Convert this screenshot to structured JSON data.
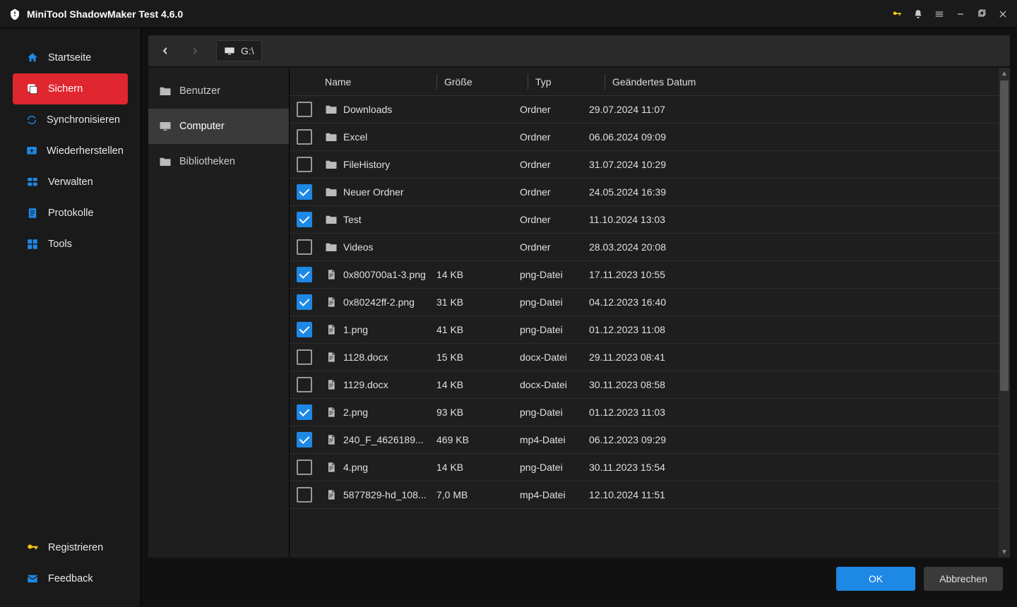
{
  "titlebar": {
    "title": "MiniTool ShadowMaker Test 4.6.0"
  },
  "sidebar": {
    "items": [
      {
        "label": "Startseite",
        "icon": "home"
      },
      {
        "label": "Sichern",
        "icon": "backup",
        "active": true
      },
      {
        "label": "Synchronisieren",
        "icon": "sync"
      },
      {
        "label": "Wiederherstellen",
        "icon": "restore"
      },
      {
        "label": "Verwalten",
        "icon": "manage"
      },
      {
        "label": "Protokolle",
        "icon": "logs"
      },
      {
        "label": "Tools",
        "icon": "tools"
      }
    ],
    "bottom": [
      {
        "label": "Registrieren",
        "icon": "key"
      },
      {
        "label": "Feedback",
        "icon": "mail"
      }
    ]
  },
  "toolbar": {
    "path": "G:\\"
  },
  "tree": {
    "items": [
      {
        "label": "Benutzer",
        "icon": "folder"
      },
      {
        "label": "Computer",
        "icon": "monitor",
        "selected": true
      },
      {
        "label": "Bibliotheken",
        "icon": "folder"
      }
    ]
  },
  "columns": {
    "name": "Name",
    "size": "Größe",
    "type": "Typ",
    "date": "Geändertes Datum"
  },
  "files": [
    {
      "checked": false,
      "icon": "folder",
      "name": "Downloads",
      "size": "",
      "type": "Ordner",
      "date": "29.07.2024 11:07"
    },
    {
      "checked": false,
      "icon": "folder",
      "name": "Excel",
      "size": "",
      "type": "Ordner",
      "date": "06.06.2024 09:09"
    },
    {
      "checked": false,
      "icon": "folder",
      "name": "FileHistory",
      "size": "",
      "type": "Ordner",
      "date": "31.07.2024 10:29"
    },
    {
      "checked": true,
      "icon": "folder",
      "name": "Neuer Ordner",
      "size": "",
      "type": "Ordner",
      "date": "24.05.2024 16:39"
    },
    {
      "checked": true,
      "icon": "folder",
      "name": "Test",
      "size": "",
      "type": "Ordner",
      "date": "11.10.2024 13:03"
    },
    {
      "checked": false,
      "icon": "folder",
      "name": "Videos",
      "size": "",
      "type": "Ordner",
      "date": "28.03.2024 20:08"
    },
    {
      "checked": true,
      "icon": "file",
      "name": "0x800700a1-3.png",
      "size": "14 KB",
      "type": "png-Datei",
      "date": "17.11.2023 10:55"
    },
    {
      "checked": true,
      "icon": "file",
      "name": "0x80242ff-2.png",
      "size": "31 KB",
      "type": "png-Datei",
      "date": "04.12.2023 16:40"
    },
    {
      "checked": true,
      "icon": "file",
      "name": "1.png",
      "size": "41 KB",
      "type": "png-Datei",
      "date": "01.12.2023 11:08"
    },
    {
      "checked": false,
      "icon": "file",
      "name": "1128.docx",
      "size": "15 KB",
      "type": "docx-Datei",
      "date": "29.11.2023 08:41"
    },
    {
      "checked": false,
      "icon": "file",
      "name": "1129.docx",
      "size": "14 KB",
      "type": "docx-Datei",
      "date": "30.11.2023 08:58"
    },
    {
      "checked": true,
      "icon": "file",
      "name": "2.png",
      "size": "93 KB",
      "type": "png-Datei",
      "date": "01.12.2023 11:03"
    },
    {
      "checked": true,
      "icon": "file",
      "name": "240_F_4626189...",
      "size": "469 KB",
      "type": "mp4-Datei",
      "date": "06.12.2023 09:29"
    },
    {
      "checked": false,
      "icon": "file",
      "name": "4.png",
      "size": "14 KB",
      "type": "png-Datei",
      "date": "30.11.2023 15:54"
    },
    {
      "checked": false,
      "icon": "file",
      "name": "5877829-hd_108...",
      "size": "7,0 MB",
      "type": "mp4-Datei",
      "date": "12.10.2024 11:51"
    }
  ],
  "footer": {
    "ok": "OK",
    "cancel": "Abbrechen"
  }
}
